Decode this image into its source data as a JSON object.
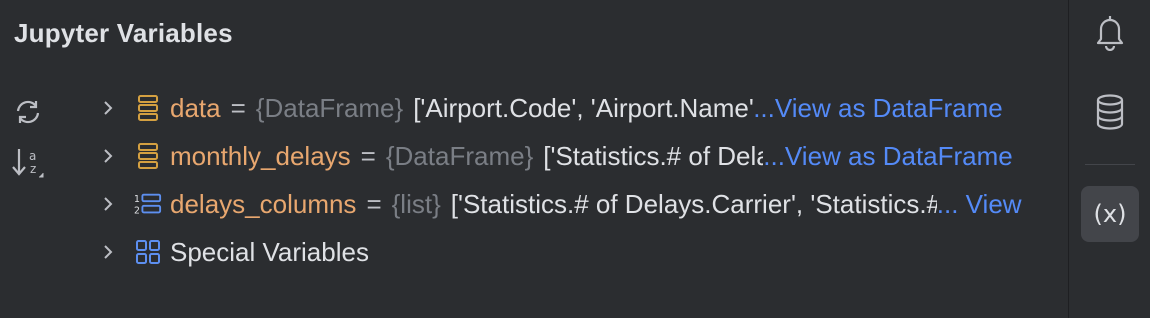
{
  "panel": {
    "title": "Jupyter Variables"
  },
  "toolbar": {
    "refresh_icon": "refresh-icon",
    "sort_icon": "sort-alpha-icon"
  },
  "variables": [
    {
      "name": "data",
      "eq": "=",
      "type": "{DataFrame}",
      "value": "['Airport.Code', 'Airport.Name', 'Airport.Name",
      "link": "...View as DataFrame",
      "icon": "dataframe-icon"
    },
    {
      "name": "monthly_delays",
      "eq": "=",
      "type": "{DataFrame}",
      "value": "['Statistics.# of Delays.Carrier'",
      "link": "...View as DataFrame",
      "icon": "dataframe-icon"
    },
    {
      "name": "delays_columns",
      "eq": "=",
      "type": "{list}",
      "value": "['Statistics.# of Delays.Carrier', 'Statistics.# of Delays",
      "link": "... View",
      "icon": "list-icon"
    }
  ],
  "special": {
    "label": "Special Variables",
    "icon": "special-variables-icon"
  },
  "sidebar": {
    "notifications_icon": "bell-icon",
    "database_icon": "database-icon",
    "variables_label": "(x)"
  },
  "colors": {
    "name": "#e8a76f",
    "type": "#7a7e85",
    "link": "#548af7",
    "icon": "#d4a041",
    "blue_icon": "#5d8ff0"
  }
}
